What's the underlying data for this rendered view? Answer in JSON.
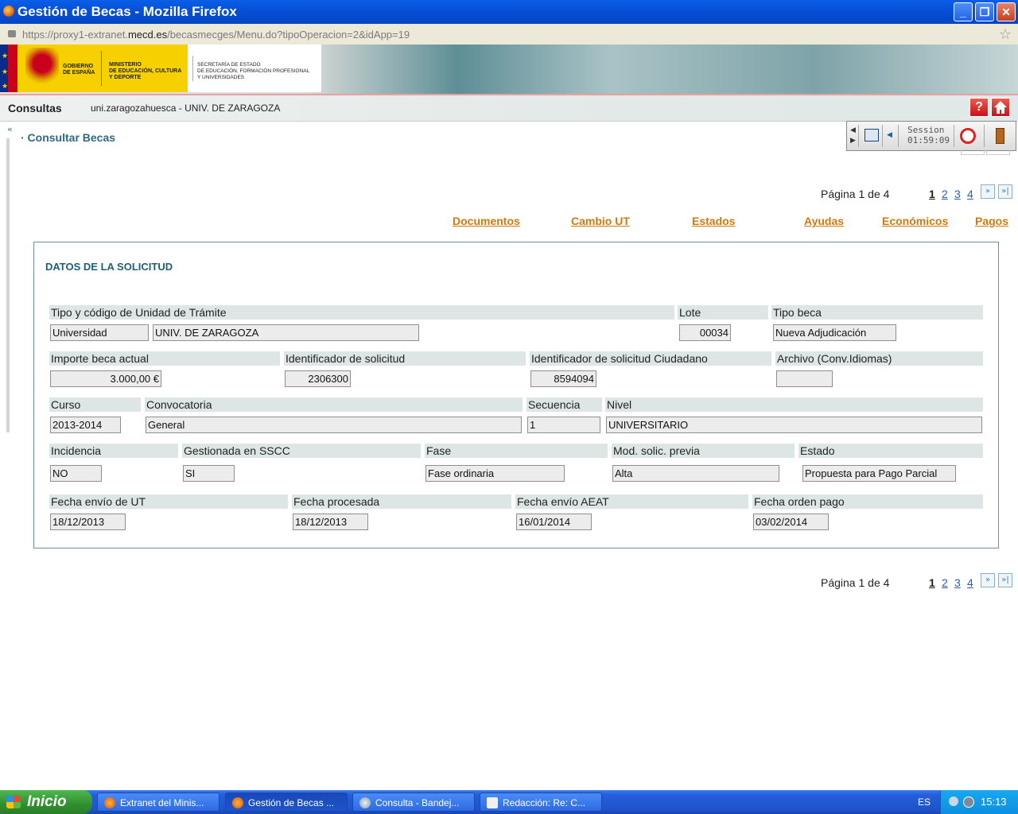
{
  "window": {
    "title": "Gestión de Becas - Mozilla Firefox"
  },
  "urlbar": {
    "prefix": "https://proxy1-extranet.",
    "host": "mecd.es",
    "path": "/becasmecges/Menu.do?tipoOperacion=2&idApp=19"
  },
  "banner": {
    "gov_line1": "GOBIERNO",
    "gov_line2": "DE ESPAÑA",
    "min_line1": "MINISTERIO",
    "min_line2": "DE EDUCACIÓN, CULTURA",
    "min_line3": "Y DEPORTE",
    "sec_line1": "SECRETARÍA DE ESTADO",
    "sec_line2": "DE EDUCACIÓN, FORMACIÓN PROFESIONAL",
    "sec_line3": "Y UNIVERSIDADES"
  },
  "header": {
    "section": "Consultas",
    "user": "uni.zaragozahuesca  - UNIV. DE ZARAGOZA",
    "help": "?"
  },
  "breadcrumb": "· Consultar Becas",
  "session": {
    "label": "Session",
    "time": "01:59:09"
  },
  "pagination": {
    "text": "Página 1 de 4",
    "pages": [
      "1",
      "2",
      "3",
      "4"
    ],
    "next": "»",
    "last": "»|"
  },
  "tabs": [
    "Documentos",
    "Cambio UT",
    "Estados",
    "Ayudas",
    "Económicos",
    "Pagos"
  ],
  "panel": {
    "title": "DATOS DE LA SOLICITUD",
    "fields": {
      "tipo_label": "Tipo y código de Unidad de Trámite",
      "tipo_val1": "Universidad",
      "tipo_val2": "UNIV. DE ZARAGOZA",
      "lote_label": "Lote",
      "lote_val": "00034",
      "tipobeca_label": "Tipo beca",
      "tipobeca_val": "Nueva Adjudicación",
      "importe_label": "Importe beca actual",
      "importe_val": "3.000,00 €",
      "ident_label": "Identificador de solicitud",
      "ident_val": "2306300",
      "identc_label": "Identificador de solicitud Ciudadano",
      "identc_val": "8594094",
      "archivo_label": "Archivo (Conv.Idiomas)",
      "archivo_val": "",
      "curso_label": "Curso",
      "curso_val": "2013-2014",
      "conv_label": "Convocatoria",
      "conv_val": "General",
      "sec_label": "Secuencia",
      "sec_val": "1",
      "nivel_label": "Nivel",
      "nivel_val": "UNIVERSITARIO",
      "inc_label": "Incidencia",
      "inc_val": "NO",
      "gest_label": "Gestionada en SSCC",
      "gest_val": "SI",
      "fase_label": "Fase",
      "fase_val": "Fase ordinaria",
      "mod_label": "Mod. solic. previa",
      "mod_val": "Alta",
      "estado_label": "Estado",
      "estado_val": "Propuesta para Pago  Parcial",
      "fenvio_label": "Fecha envío de UT",
      "fenvio_val": "18/12/2013",
      "fproc_label": "Fecha procesada",
      "fproc_val": "18/12/2013",
      "faeat_label": "Fecha envío AEAT",
      "faeat_val": "16/01/2014",
      "forden_label": "Fecha orden pago",
      "forden_val": "03/02/2014"
    }
  },
  "taskbar": {
    "start": "Inicio",
    "tasks": [
      "Extranet del Minis...",
      "Gestión de Becas ...",
      "Consulta - Bandej...",
      "Redacción: Re: C..."
    ],
    "lang": "ES",
    "clock": "15:13"
  },
  "colors": {
    "accent": "#1f5f74",
    "link": "#d4780c",
    "titlebar": "#0751d8"
  }
}
